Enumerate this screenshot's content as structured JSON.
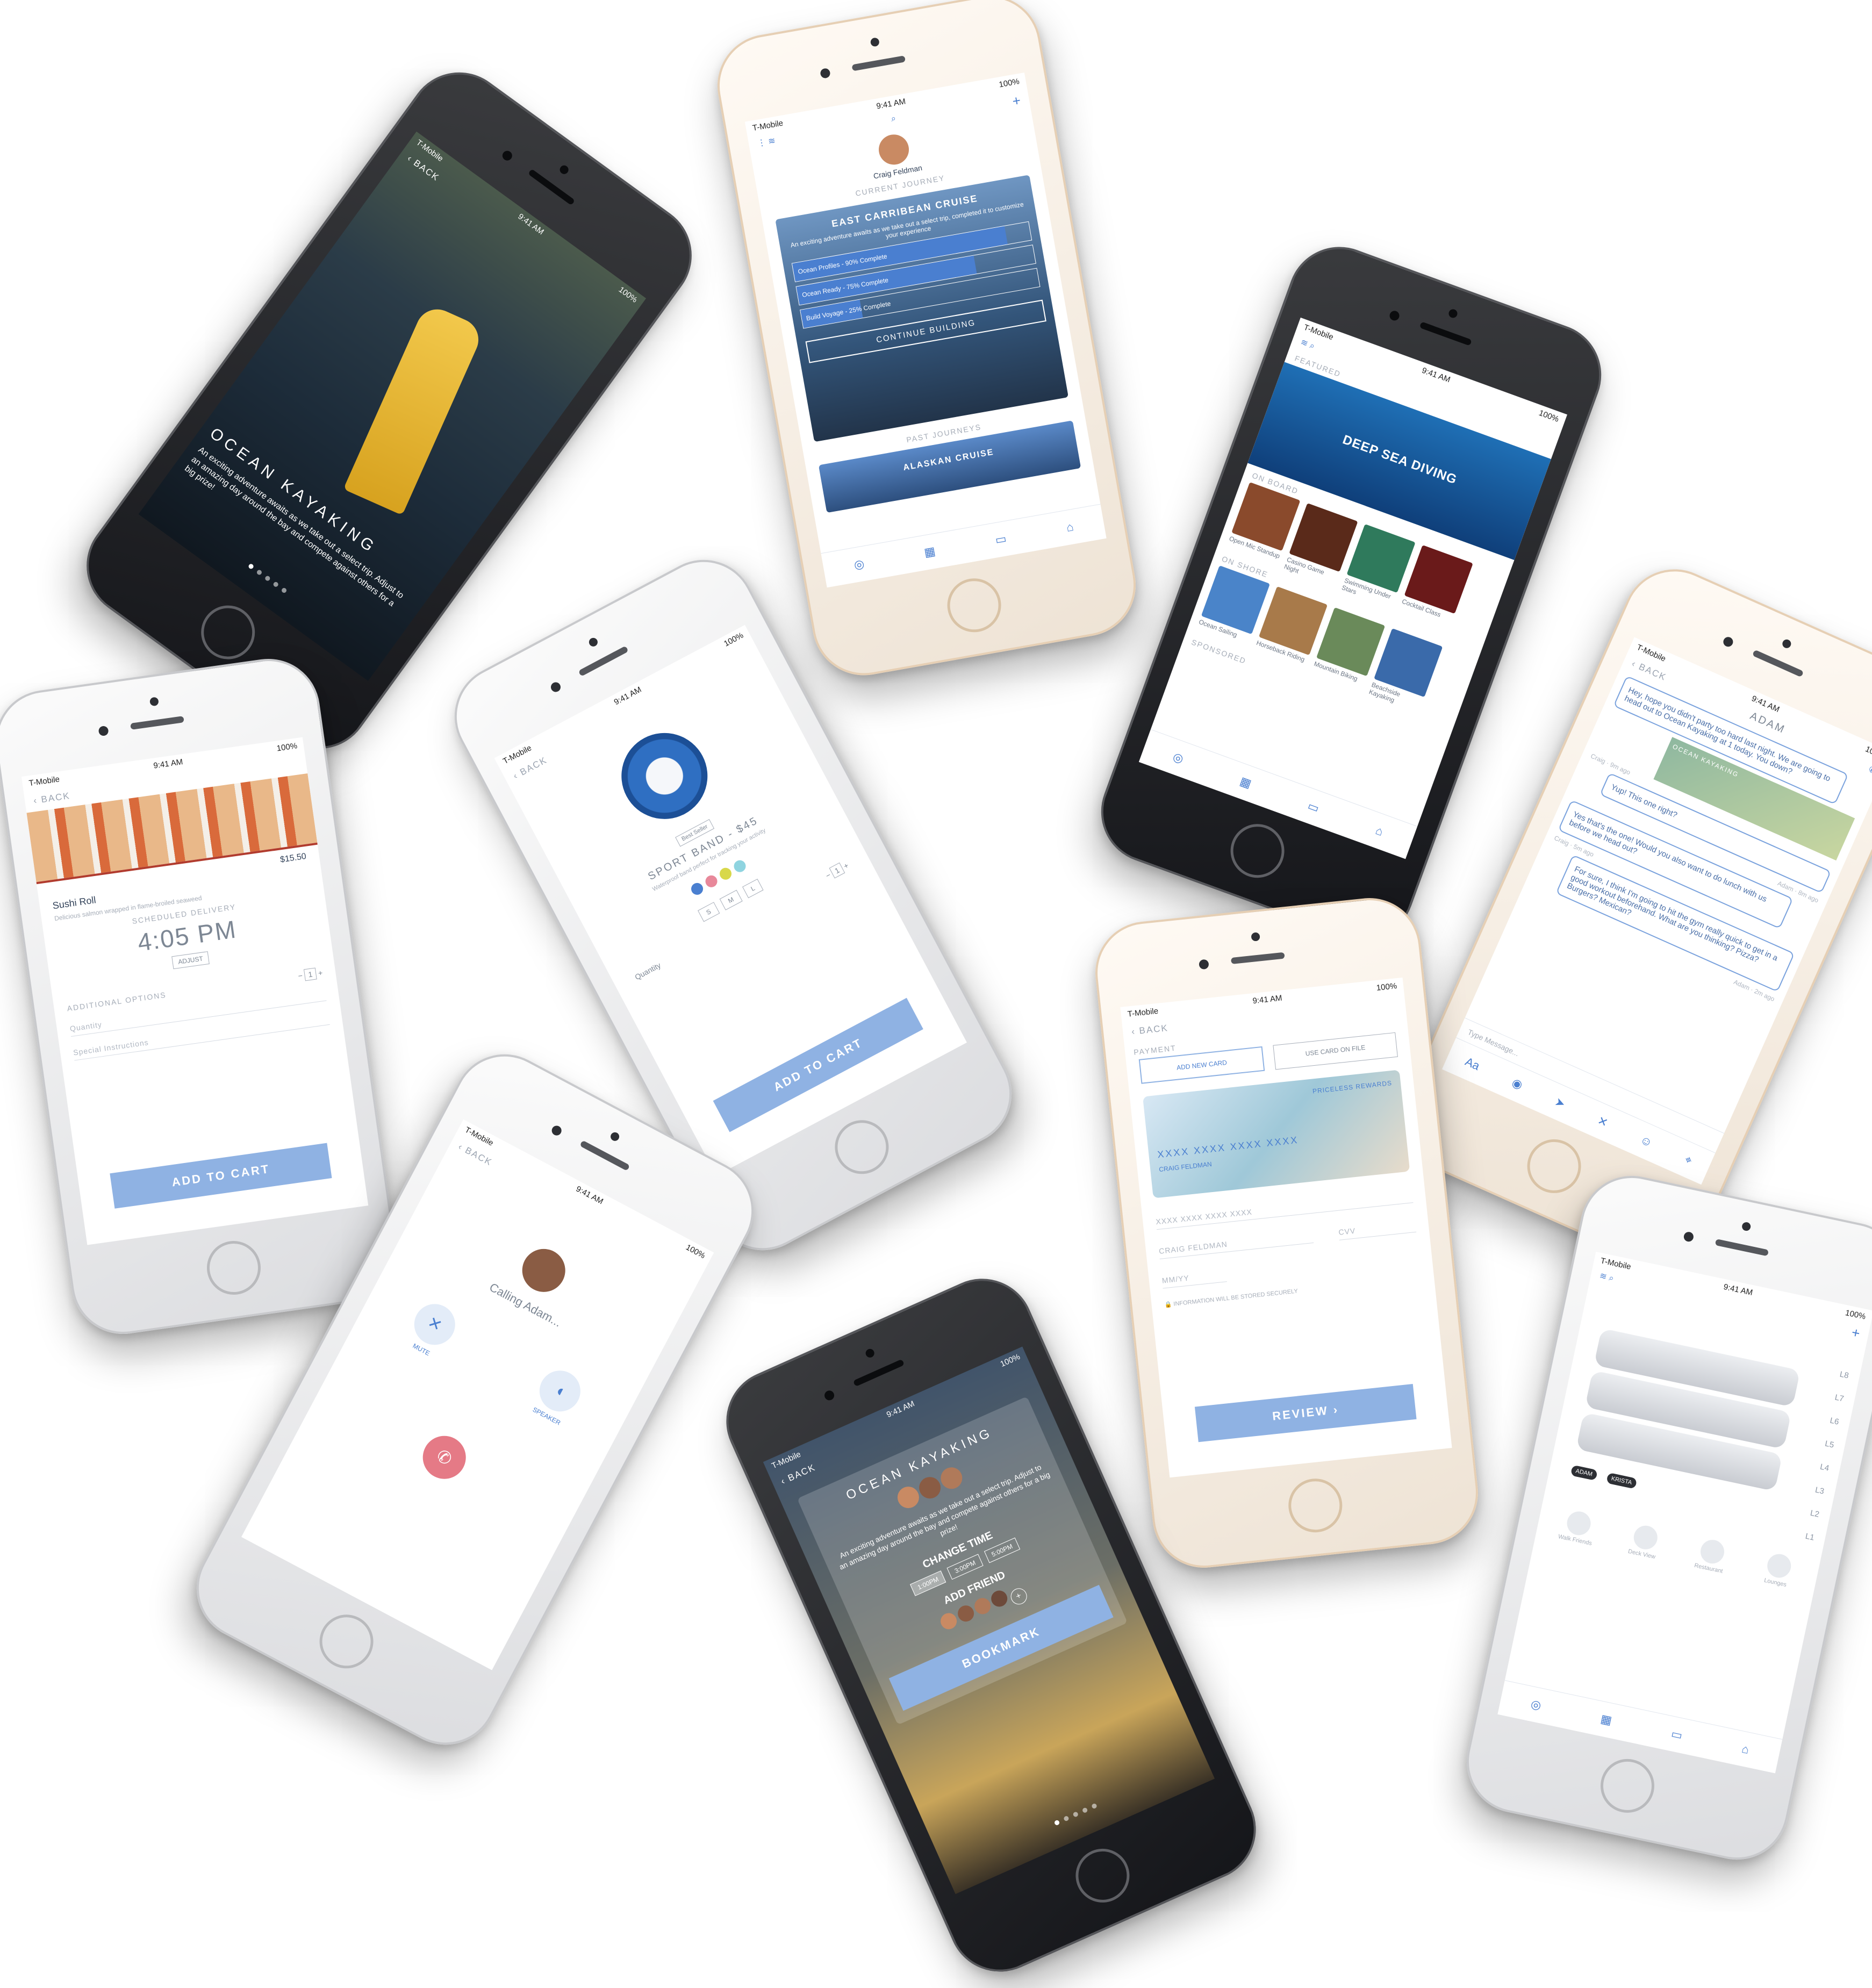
{
  "status": {
    "carrier": "T-Mobile",
    "time": "9:41 AM",
    "battery": "100%"
  },
  "common": {
    "back_label": "BACK",
    "add_to_cart": "ADD TO CART",
    "quantity_label": "Quantity"
  },
  "kayak_story": {
    "title": "OCEAN KAYAKING",
    "body": "An exciting adventure awaits as we take out a select trip. Adjust to an amazing day around the bay and compete against others for a big prize!"
  },
  "journey": {
    "user_name": "Craig Feldman",
    "current_label": "CURRENT JOURNEY",
    "cruise_title": "EAST CARRIBEAN CRUISE",
    "cruise_desc": "An exciting adventure awaits as we take out a select trip, completed it to customize your experience",
    "progress": [
      {
        "label": "Ocean Profiles - 90% Complete",
        "pct": 90
      },
      {
        "label": "Ocean Ready - 75% Complete",
        "pct": 75
      },
      {
        "label": "Build Voyage - 25% Complete",
        "pct": 25
      }
    ],
    "continue_button": "CONTINUE BUILDING",
    "past_label": "PAST JOURNEYS",
    "past_cruise": "ALASKAN CRUISE",
    "tabs": [
      "Discover",
      "Calendar",
      "Chat",
      "Shop"
    ]
  },
  "discover": {
    "featured_label": "FEATURED",
    "featured_title": "DEEP SEA DIVING",
    "onboard_label": "ON BOARD",
    "onboard_items": [
      "Open Mic Standup",
      "Casino Game Night",
      "Swimming Under Stars",
      "Cocktail Class"
    ],
    "onshore_label": "ON SHORE",
    "onshore_items": [
      "Ocean Sailing",
      "Horseback Riding",
      "Mountain Biking",
      "Beachside Kayaking"
    ],
    "sponsored_label": "SPONSORED"
  },
  "sushi": {
    "price": "$15.50",
    "item_name": "Sushi Roll",
    "item_desc": "Delicious salmon wrapped in flame-broiled seaweed",
    "delivery_label": "SCHEDULED DELIVERY",
    "delivery_time": "4:05 PM",
    "adjust_button": "ADJUST",
    "options_label": "ADDITIONAL OPTIONS",
    "quantity_value": "1",
    "special_label": "Special Instructions"
  },
  "band": {
    "badge": "Best Seller",
    "title": "SPORT BAND - $45",
    "desc": "Waterproof band perfect for tracking your activity",
    "colors": [
      "#4a7fd0",
      "#e8889a",
      "#d8d84a",
      "#8fd4e0"
    ],
    "sizes": [
      "S",
      "M",
      "L"
    ],
    "quantity_value": "1"
  },
  "chat": {
    "contact": "ADAM",
    "messages": [
      {
        "from": "left",
        "text": "Hey, hope you didn't party too hard last night. We are going to head out to Ocean Kayaking at 1 today. You down?",
        "meta": "Craig · 9m ago"
      },
      {
        "from": "right",
        "text": "Yup! This one right?",
        "meta": "Adam · 8m ago"
      },
      {
        "from": "left",
        "text": "Yes that's the one! Would you also want to do lunch with us before we head out?",
        "meta": "Craig · 5m ago"
      },
      {
        "from": "right",
        "text": "For sure, I think I'm going to hit the gym really quick to get in a good workout beforehand. What are you thinking? Pizza? Burgers? Mexican?",
        "meta": "Adam · 2m ago"
      }
    ],
    "card_label": "OCEAN KAYAKING",
    "input_placeholder": "Type Message..."
  },
  "payment": {
    "section_label": "PAYMENT",
    "add_card": "ADD NEW CARD",
    "use_card": "USE CARD ON FILE",
    "card_brand": "PRICELESS REWARDS",
    "card_number": "XXXX XXXX XXXX XXXX",
    "card_holder": "CRAIG FELDMAN",
    "field_number": "XXXX XXXX XXXX XXXX",
    "field_name": "CRAIG FELDMAN",
    "field_cvv": "CVV",
    "field_exp": "MM/YY",
    "secure_note": "INFORMATION WILL BE STORED SECURELY",
    "review_button": "REVIEW"
  },
  "call": {
    "calling_text": "Calling Adam...",
    "mute_label": "MUTE",
    "speaker_label": "SPEAKER"
  },
  "kayak_booking": {
    "title": "OCEAN KAYAKING",
    "body": "An exciting adventure awaits as we take out a select trip. Adjust to an amazing day around the bay and compete against others for a big prize!",
    "change_time": "CHANGE TIME",
    "times": [
      "1:00PM",
      "3:00PM",
      "5:00PM"
    ],
    "add_friend": "ADD FRIEND",
    "bookmark": "BOOKMARK"
  },
  "ship_map": {
    "levels": [
      "L8",
      "L7",
      "L6",
      "L5",
      "L4",
      "L3",
      "L2",
      "L1"
    ],
    "pins": [
      "ADAM",
      "KRISTA"
    ],
    "controls": [
      "Walk Friends",
      "Deck View",
      "Restaurant",
      "Lounges"
    ]
  },
  "colors": {
    "accent": "#4a7fd0",
    "button": "#8fb2e3",
    "decline": "#e57a86"
  }
}
